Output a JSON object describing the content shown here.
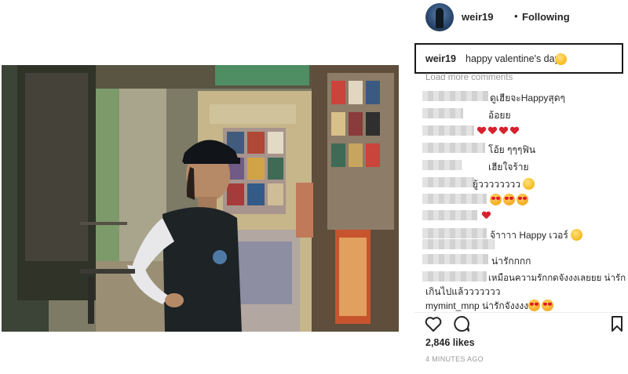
{
  "post": {
    "username": "weir19",
    "separator": "•",
    "follow_status": "Following",
    "caption_username": "weir19",
    "caption_text": "happy valentine's day",
    "caption_emoji": "yum-emoji",
    "load_more": "Load more comments",
    "likes": "2,846 likes",
    "time": "4 MINUTES AGO"
  },
  "comments": [
    {
      "text": "ดูเฮียจะHappyสุดๆ"
    },
    {
      "text": "อ้อยย"
    },
    {
      "text": "",
      "hearts": 4
    },
    {
      "text": "โอ้ย ๆๆๆฟิน"
    },
    {
      "text": "เฮียใจร้าย"
    },
    {
      "text": "ยู้วววววววว"
    },
    {
      "text": "",
      "heart_eyes": 3
    },
    {
      "text": "",
      "hearts": 1
    },
    {
      "text": "จ้าาาา Happy เวอร์"
    },
    {
      "text": "น่ารักกกก"
    },
    {
      "text": "เหมือนความรักกดจังงงเลยยย น่ารัก"
    },
    {
      "text": "เกินไปแล้ววววววว"
    },
    {
      "text": "mymint_mnp น่ารักจังงงง"
    }
  ],
  "icons": {
    "like": "heart-outline-icon",
    "comment": "comment-bubble-icon",
    "save": "bookmark-icon"
  },
  "colors": {
    "text": "#262626",
    "muted": "#999999",
    "heart": "#d8202f",
    "caption_border": "#1a1a1a"
  }
}
